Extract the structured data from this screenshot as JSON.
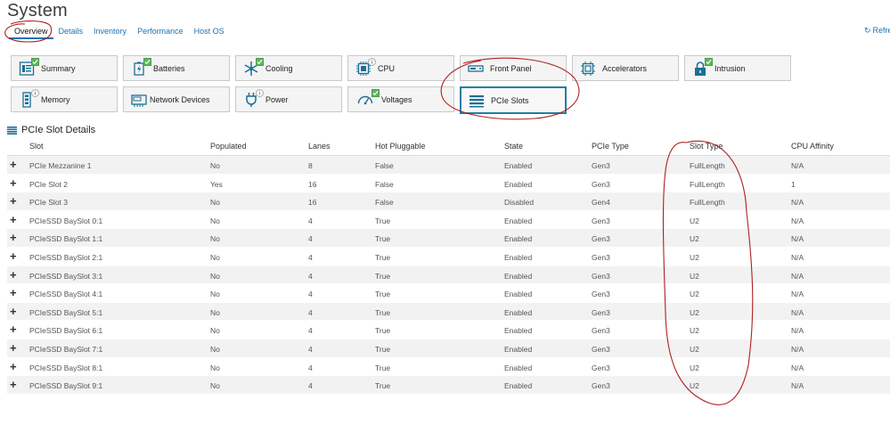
{
  "page": {
    "title": "System"
  },
  "tabs": [
    {
      "label": "Overview"
    },
    {
      "label": "Details"
    },
    {
      "label": "Inventory"
    },
    {
      "label": "Performance"
    },
    {
      "label": "Host OS"
    }
  ],
  "refresh": {
    "label": "Refre",
    "icon": "refresh-icon"
  },
  "tiles": [
    {
      "label": "Summary",
      "icon": "summary-icon",
      "status": "ok"
    },
    {
      "label": "Batteries",
      "icon": "battery-icon",
      "status": "ok"
    },
    {
      "label": "Cooling",
      "icon": "fan-icon",
      "status": "ok"
    },
    {
      "label": "CPU",
      "icon": "cpu-icon",
      "status": "info"
    },
    {
      "label": "Front Panel",
      "icon": "front-panel-icon",
      "status": "none"
    },
    {
      "label": "Accelerators",
      "icon": "accelerator-icon",
      "status": "none"
    },
    {
      "label": "Intrusion",
      "icon": "lock-icon",
      "status": "ok"
    },
    {
      "label": "Memory",
      "icon": "memory-icon",
      "status": "info"
    },
    {
      "label": "Network Devices",
      "icon": "network-card-icon",
      "status": "none"
    },
    {
      "label": "Power",
      "icon": "power-plug-icon",
      "status": "info"
    },
    {
      "label": "Voltages",
      "icon": "gauge-icon",
      "status": "ok"
    },
    {
      "label": "PCIe Slots",
      "icon": "pcie-slots-icon",
      "status": "none",
      "selected": true
    }
  ],
  "section": {
    "title": "PCIe Slot Details"
  },
  "table": {
    "columns": [
      "Slot",
      "Populated",
      "Lanes",
      "Hot Pluggable",
      "State",
      "PCIe Type",
      "Slot Type",
      "CPU Affinity"
    ],
    "rows": [
      [
        "PCIe Mezzanine 1",
        "No",
        "8",
        "False",
        "Enabled",
        "Gen3",
        "FullLength",
        "N/A"
      ],
      [
        "PCIe Slot 2",
        "Yes",
        "16",
        "False",
        "Enabled",
        "Gen3",
        "FullLength",
        "1"
      ],
      [
        "PCIe Slot 3",
        "No",
        "16",
        "False",
        "Disabled",
        "Gen4",
        "FullLength",
        "N/A"
      ],
      [
        "PCIeSSD BaySlot 0:1",
        "No",
        "4",
        "True",
        "Enabled",
        "Gen3",
        "U2",
        "N/A"
      ],
      [
        "PCIeSSD BaySlot 1:1",
        "No",
        "4",
        "True",
        "Enabled",
        "Gen3",
        "U2",
        "N/A"
      ],
      [
        "PCIeSSD BaySlot 2:1",
        "No",
        "4",
        "True",
        "Enabled",
        "Gen3",
        "U2",
        "N/A"
      ],
      [
        "PCIeSSD BaySlot 3:1",
        "No",
        "4",
        "True",
        "Enabled",
        "Gen3",
        "U2",
        "N/A"
      ],
      [
        "PCIeSSD BaySlot 4:1",
        "No",
        "4",
        "True",
        "Enabled",
        "Gen3",
        "U2",
        "N/A"
      ],
      [
        "PCIeSSD BaySlot 5:1",
        "No",
        "4",
        "True",
        "Enabled",
        "Gen3",
        "U2",
        "N/A"
      ],
      [
        "PCIeSSD BaySlot 6:1",
        "No",
        "4",
        "True",
        "Enabled",
        "Gen3",
        "U2",
        "N/A"
      ],
      [
        "PCIeSSD BaySlot 7:1",
        "No",
        "4",
        "True",
        "Enabled",
        "Gen3",
        "U2",
        "N/A"
      ],
      [
        "PCIeSSD BaySlot 8:1",
        "No",
        "4",
        "True",
        "Enabled",
        "Gen3",
        "U2",
        "N/A"
      ],
      [
        "PCIeSSD BaySlot 9:1",
        "No",
        "4",
        "True",
        "Enabled",
        "Gen3",
        "U2",
        "N/A"
      ]
    ]
  },
  "colors": {
    "link": "#1a73b5",
    "ok": "#5cb85c",
    "selected_border": "#1b7fa6",
    "annotation": "#b02020"
  }
}
